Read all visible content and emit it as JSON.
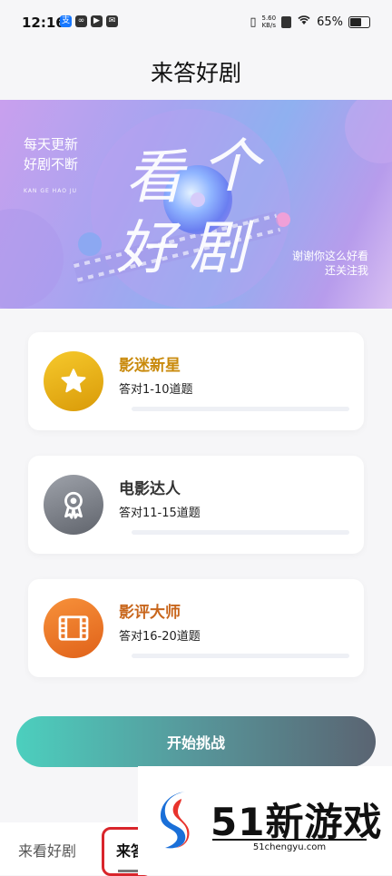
{
  "status_bar": {
    "time": "12:16",
    "net_speed_value": "5.60",
    "net_speed_unit": "KB/s",
    "battery": "65%"
  },
  "page": {
    "title": "来答好剧"
  },
  "banner": {
    "left_line1": "每天更新",
    "left_line2": "好剧不断",
    "left_small": "KAN GE HAO JU",
    "big_1": "看",
    "big_2": "个",
    "big_3": "好",
    "big_4": "剧",
    "right_line1": "谢谢你这么好看",
    "right_line2": "还关注我"
  },
  "levels": [
    {
      "title": "影迷新星",
      "subtitle": "答对1-10道题",
      "title_color": "#c98a0c",
      "icon": "star-icon",
      "progress": 0
    },
    {
      "title": "电影达人",
      "subtitle": "答对11-15道题",
      "title_color": "#333333",
      "icon": "award-ribbon-icon",
      "progress": 0
    },
    {
      "title": "影评大师",
      "subtitle": "答对16-20道题",
      "title_color": "#c8661c",
      "icon": "film-icon",
      "progress": 0
    }
  ],
  "start_button": {
    "label": "开始挑战"
  },
  "tabs": [
    {
      "label": "来看好剧"
    },
    {
      "label": "来答"
    }
  ],
  "watermark": {
    "brand": "51新游戏",
    "url": "51chengyu.com"
  }
}
